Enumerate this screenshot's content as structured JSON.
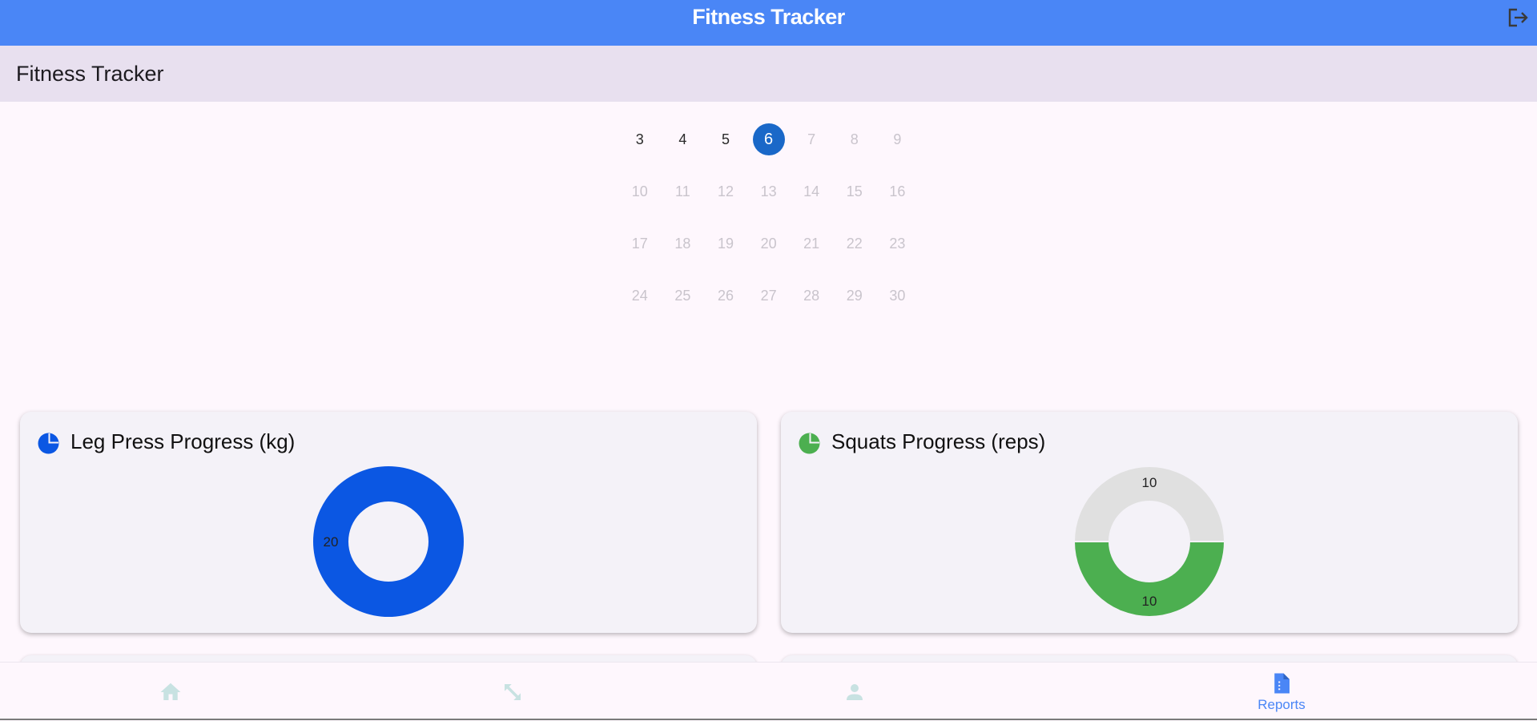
{
  "header": {
    "title": "Fitness Tracker",
    "logout_icon": "logout-icon"
  },
  "subheader": {
    "title": "Fitness Tracker"
  },
  "calendar": {
    "selected": 6,
    "weeks": [
      [
        "3",
        "4",
        "5",
        "6",
        "7",
        "8",
        "9"
      ],
      [
        "10",
        "11",
        "12",
        "13",
        "14",
        "15",
        "16"
      ],
      [
        "17",
        "18",
        "19",
        "20",
        "21",
        "22",
        "23"
      ],
      [
        "24",
        "25",
        "26",
        "27",
        "28",
        "29",
        "30"
      ]
    ]
  },
  "cards": [
    {
      "title": "Leg Press Progress (kg)",
      "icon": "pie-chart-icon",
      "color": "#0b57e3",
      "chart_data": {
        "type": "pie",
        "title": "Leg Press Progress (kg)",
        "slices": [
          {
            "label": "20",
            "value": 20,
            "color": "#0b57e3"
          }
        ]
      }
    },
    {
      "title": "Squats Progress (reps)",
      "icon": "pie-chart-icon",
      "color": "#4caf50",
      "chart_data": {
        "type": "pie",
        "title": "Squats Progress (reps)",
        "slices": [
          {
            "label": "10",
            "value": 10,
            "color": "#e0e0e0"
          },
          {
            "label": "10",
            "value": 10,
            "color": "#4caf50"
          }
        ]
      }
    }
  ],
  "bottom_nav": {
    "items": [
      {
        "icon": "home-icon",
        "label": ""
      },
      {
        "icon": "expand-arrows-icon",
        "label": ""
      },
      {
        "icon": "person-icon",
        "label": ""
      },
      {
        "icon": "report-icon",
        "label": "Reports",
        "active": true
      }
    ]
  },
  "colors": {
    "primary": "#4a86f6",
    "nav_inactive": "#c8e2e2"
  }
}
